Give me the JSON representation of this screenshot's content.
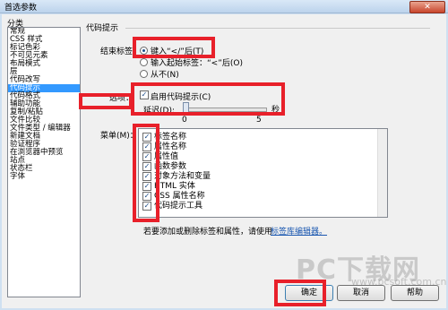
{
  "window": {
    "title": "首选参数",
    "close_label": "✕"
  },
  "categories": {
    "header": "分类",
    "items": [
      "常规",
      "CSS 样式",
      "标记色彩",
      "不可见元素",
      "布局模式",
      "层",
      "代码改写",
      "代码提示",
      "代码格式",
      "辅助功能",
      "复制/粘贴",
      "文件比较",
      "文件类型 / 编辑器",
      "新建文档",
      "验证程序",
      "在浏览器中预览",
      "站点",
      "状态栏",
      "字体"
    ],
    "selected_index": 7
  },
  "section_title": "代码提示",
  "close_tags": {
    "label": "结束标签：",
    "options": [
      "键入“</”后(T)",
      "输入起始标签：“<”后(O)",
      "从不(N)"
    ],
    "selected_index": 0
  },
  "options_group": {
    "label": "选项：",
    "enable_hints_label": "启用代码提示(C)",
    "enable_hints_checked": true,
    "delay_label": "延迟(D):",
    "delay_unit": "秒",
    "delay_min_label": "0",
    "delay_max_label": "5",
    "delay_value": 0
  },
  "menus": {
    "label": "菜单(M)：",
    "items": [
      "标签名称",
      "属性名称",
      "属性值",
      "函数参数",
      "对象方法和变量",
      "HTML 实体",
      "CSS 属性名称",
      "代码提示工具"
    ],
    "checked": [
      true,
      true,
      true,
      true,
      true,
      true,
      true,
      true
    ]
  },
  "hint_text": "若要添加或删除标签和属性，请使用",
  "hint_link": "标签库编辑器。",
  "buttons": {
    "ok": "确定",
    "cancel": "取消",
    "help": "帮助"
  },
  "watermark": {
    "main": "PC下载网",
    "sub": "www.pcsoft.com.cn"
  },
  "annotation_color": "#e8202a"
}
